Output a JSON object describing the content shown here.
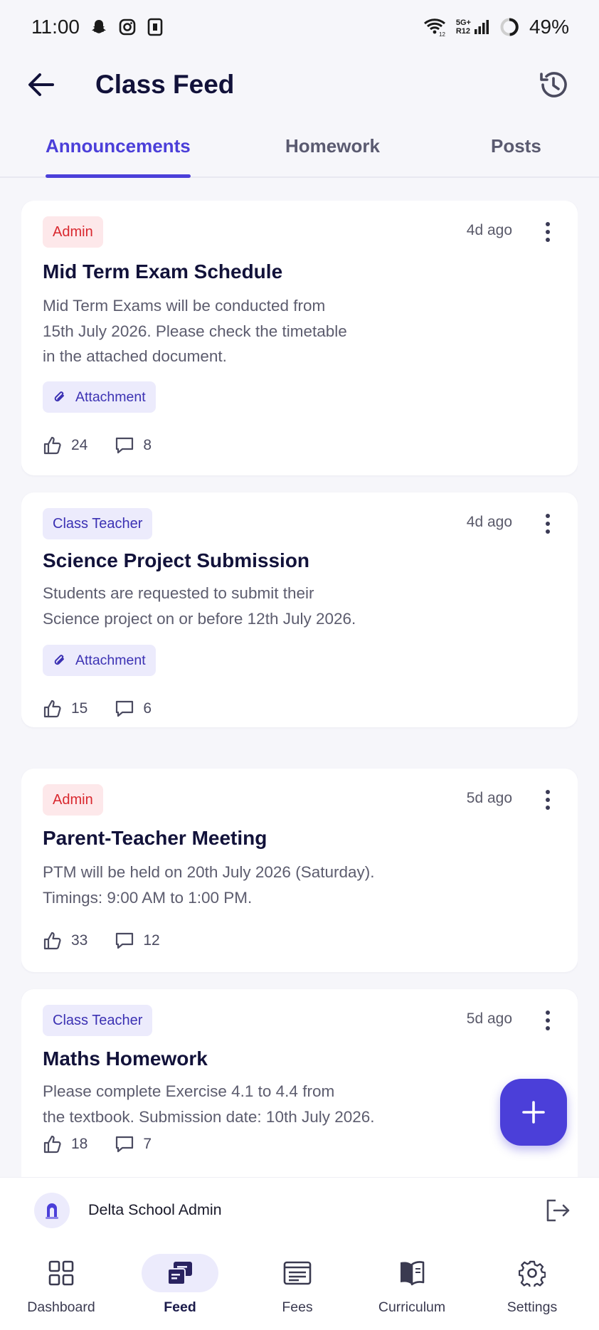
{
  "status_bar": {
    "time": "11:00",
    "network_label": "5G+",
    "network_sub": "R12",
    "wifi_sub": "12",
    "battery": "49%",
    "icons": [
      "snapchat-icon",
      "instagram-icon",
      "sim-icon",
      "wifi-icon",
      "signal-icon",
      "battery-ring-icon"
    ]
  },
  "header": {
    "title": "Class Feed",
    "back_icon": "arrow-left-icon",
    "history_icon": "history-icon"
  },
  "tabs": [
    {
      "label": "Announcements",
      "active": true
    },
    {
      "label": "Homework",
      "active": false
    },
    {
      "label": "Posts",
      "active": false
    }
  ],
  "posts": [
    {
      "badge": "Admin",
      "badge_type": "admin",
      "time": "4d ago",
      "title": "Mid Term Exam Schedule",
      "body": [
        "Mid Term Exams will be conducted from",
        "15th July 2026. Please check the timetable",
        "in the attached document."
      ],
      "attachment": "Attachment",
      "likes": "24",
      "comments": "8"
    },
    {
      "badge": "Class Teacher",
      "badge_type": "teacher",
      "time": "4d ago",
      "title": "Science Project Submission",
      "body": [
        "Students are requested to submit their",
        "Science project on or before 12th July 2026."
      ],
      "attachment": "Attachment",
      "likes": "15",
      "comments": "6"
    },
    {
      "badge": "Admin",
      "badge_type": "admin",
      "time": "5d ago",
      "title": "Parent-Teacher Meeting",
      "body": [
        "PTM will be held on 20th July 2026 (Saturday).",
        "Timings: 9:00 AM to 1:00 PM."
      ],
      "likes": "33",
      "comments": "12"
    },
    {
      "badge": "Class Teacher",
      "badge_type": "teacher",
      "time": "5d ago",
      "title": "Maths Homework",
      "body": [
        "Please complete Exercise 4.1 to 4.4 from",
        "the textbook. Submission date: 10th July 2026."
      ],
      "likes": "18",
      "comments": "7"
    }
  ],
  "fab_icon": "plus-icon",
  "account": {
    "name": "Delta School Admin",
    "avatar_icon": "school-logo-icon",
    "logout_icon": "logout-icon"
  },
  "bottom_nav": [
    {
      "label": "Dashboard",
      "icon": "grid-icon",
      "active": false
    },
    {
      "label": "Feed",
      "icon": "feed-icon",
      "active": true
    },
    {
      "label": "Fees",
      "icon": "receipt-icon",
      "active": false
    },
    {
      "label": "Curriculum",
      "icon": "book-icon",
      "active": false
    },
    {
      "label": "Settings",
      "icon": "gear-icon",
      "active": false
    }
  ],
  "colors": {
    "accent": "#4b3fd9",
    "admin_badge_bg": "#fde8ea",
    "admin_badge_text": "#d9282f",
    "teacher_badge_bg": "#ecebfc",
    "teacher_badge_text": "#3b31b3",
    "background": "#f6f6fa"
  }
}
